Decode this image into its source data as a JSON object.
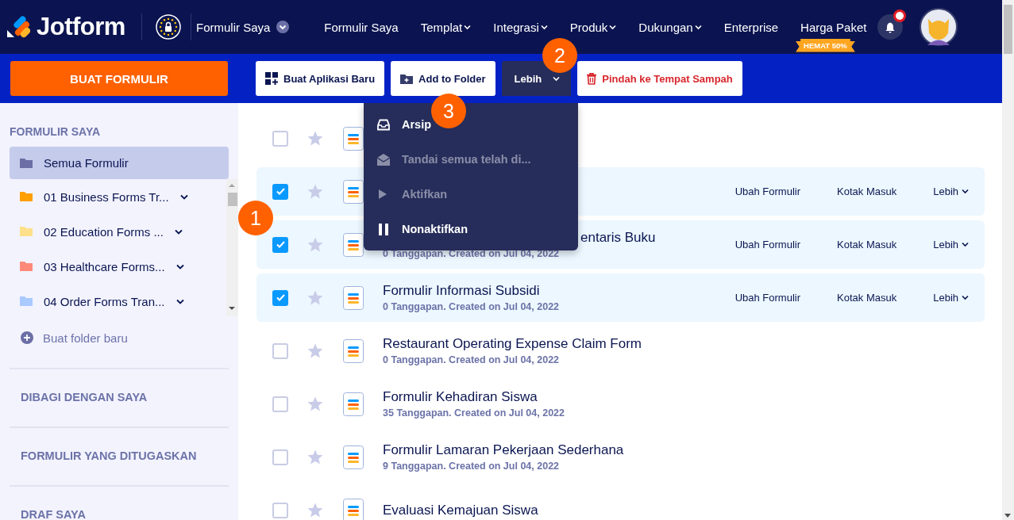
{
  "header": {
    "logo": "Jotform",
    "workspace": "Formulir Saya",
    "nav": [
      {
        "label": "Formulir Saya",
        "dropdown": false
      },
      {
        "label": "Templat",
        "dropdown": true
      },
      {
        "label": "Integrasi",
        "dropdown": true
      },
      {
        "label": "Produk",
        "dropdown": true
      },
      {
        "label": "Dukungan",
        "dropdown": true
      },
      {
        "label": "Enterprise",
        "dropdown": false
      },
      {
        "label": "Harga Paket",
        "dropdown": false,
        "ribbon": "HEMAT 50%"
      }
    ],
    "notifications": {
      "unread": true
    }
  },
  "toolbar": {
    "create_button": "BUAT FORMULIR",
    "actions": [
      {
        "label": "Buat Aplikasi Baru",
        "kind": "apps",
        "open": false
      },
      {
        "label": "Add to Folder",
        "kind": "folder",
        "open": false
      },
      {
        "label": "Lebih",
        "kind": "more",
        "open": true
      },
      {
        "label": "Pindah ke Tempat Sampah",
        "kind": "trash",
        "open": false
      }
    ]
  },
  "more_menu": {
    "items": [
      {
        "label": "Arsip",
        "kind": "archive",
        "disabled": false
      },
      {
        "label": "Tandai semua telah di...",
        "kind": "read",
        "disabled": true
      },
      {
        "label": "Aktifkan",
        "kind": "play",
        "disabled": true
      },
      {
        "label": "Nonaktifkan",
        "kind": "pause",
        "disabled": false
      }
    ]
  },
  "sidebar": {
    "heading": "FORMULIR SAYA",
    "items": [
      {
        "label": "Semua Formulir",
        "selected": true,
        "color": "#6b6fa6",
        "expandable": false
      },
      {
        "label": "01 Business Forms Tr...",
        "selected": false,
        "color": "#ff9f00",
        "expandable": true
      },
      {
        "label": "02 Education Forms ...",
        "selected": false,
        "color": "#ffe08a",
        "expandable": true
      },
      {
        "label": "03 Healthcare Forms...",
        "selected": false,
        "color": "#ff8a7a",
        "expandable": true
      },
      {
        "label": "04 Order Forms Tran...",
        "selected": false,
        "color": "#a9c9ff",
        "expandable": true
      }
    ],
    "new_folder": "Buat folder baru",
    "sections": [
      "DIBAGI DENGAN SAYA",
      "FORMULIR YANG DITUGASKAN",
      "DRAF SAYA"
    ]
  },
  "forms": [
    {
      "selected": false,
      "starred": false
    },
    {
      "selected": true,
      "starred": false,
      "actions": [
        {
          "label": "Ubah Formulir",
          "dropdown": false
        },
        {
          "label": "Kotak Masuk",
          "dropdown": false
        },
        {
          "label": "Lebih",
          "dropdown": true
        }
      ]
    },
    {
      "selected": true,
      "starred": false,
      "title": "entaris Buku",
      "title_cut": true,
      "meta": "0 Tanggapan. Created on Jul 04, 2022",
      "actions": [
        {
          "label": "Ubah Formulir",
          "dropdown": false
        },
        {
          "label": "Kotak Masuk",
          "dropdown": false
        },
        {
          "label": "Lebih",
          "dropdown": true
        }
      ]
    },
    {
      "selected": true,
      "starred": false,
      "title": "Formulir Informasi Subsidi",
      "meta": "0 Tanggapan. Created on Jul 04, 2022",
      "actions": [
        {
          "label": "Ubah Formulir",
          "dropdown": false
        },
        {
          "label": "Kotak Masuk",
          "dropdown": false
        },
        {
          "label": "Lebih",
          "dropdown": true
        }
      ]
    },
    {
      "selected": false,
      "starred": false,
      "title": "Restaurant Operating Expense Claim Form",
      "meta": "0 Tanggapan. Created on Jul 04, 2022"
    },
    {
      "selected": false,
      "starred": false,
      "title": "Formulir Kehadiran Siswa",
      "meta": "35 Tanggapan. Created on Jul 04, 2022"
    },
    {
      "selected": false,
      "starred": false,
      "title": "Formulir Lamaran Pekerjaan Sederhana",
      "meta": "9 Tanggapan. Created on Jul 04, 2022"
    },
    {
      "selected": false,
      "starred": false,
      "title": "Evaluasi Kemajuan Siswa"
    }
  ],
  "callouts": [
    "1",
    "2",
    "3"
  ]
}
